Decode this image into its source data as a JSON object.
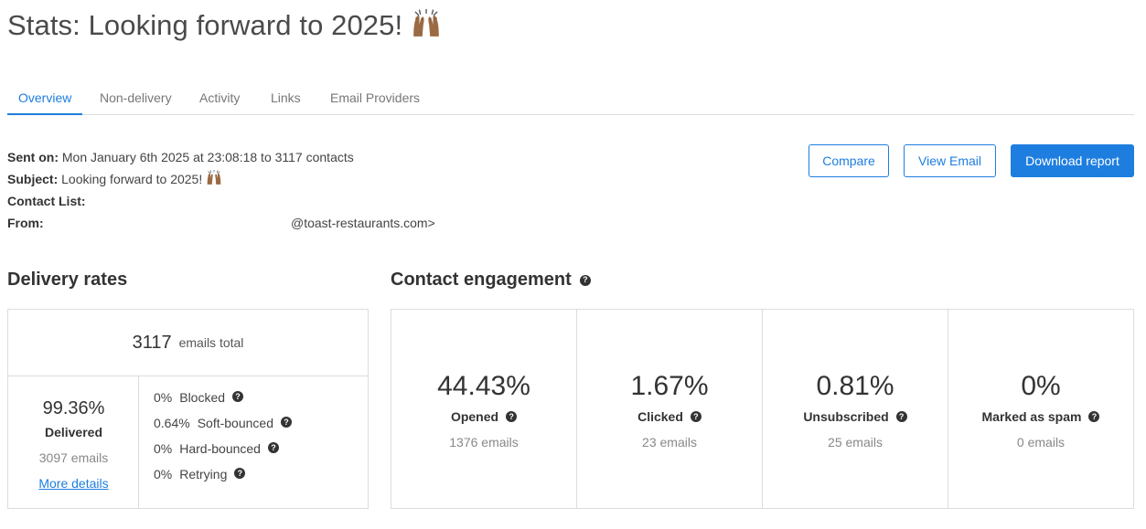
{
  "header": {
    "title": "Stats: Looking forward to 2025!",
    "emoji": "raised-hands"
  },
  "tabs": [
    {
      "label": "Overview",
      "active": true
    },
    {
      "label": "Non-delivery",
      "active": false
    },
    {
      "label": "Activity",
      "active": false
    },
    {
      "label": "Links",
      "active": false
    },
    {
      "label": "Email Providers",
      "active": false
    }
  ],
  "meta": {
    "sent_on_label": "Sent on:",
    "sent_on_value": "Mon January 6th 2025 at 23:08:18 to 3117 contacts",
    "subject_label": "Subject:",
    "subject_value": "Looking forward to 2025!",
    "contact_list_label": "Contact List:",
    "from_label": "From:",
    "from_value": "@toast-restaurants.com>"
  },
  "actions": {
    "compare": "Compare",
    "view_email": "View Email",
    "download": "Download report"
  },
  "colors": {
    "accent": "#1e7ee0",
    "border": "#dcdcdc",
    "text": "#444444"
  },
  "delivery": {
    "title": "Delivery rates",
    "total": "3117",
    "total_label": "emails total",
    "delivered_pct": "99.36%",
    "delivered_label": "Delivered",
    "delivered_count": "3097 emails",
    "more_details": "More details",
    "failures": [
      {
        "pct": "0%",
        "label": "Blocked"
      },
      {
        "pct": "0.64%",
        "label": "Soft-bounced"
      },
      {
        "pct": "0%",
        "label": "Hard-bounced"
      },
      {
        "pct": "0%",
        "label": "Retrying"
      }
    ]
  },
  "engagement": {
    "title": "Contact engagement",
    "cards": [
      {
        "pct": "44.43%",
        "label": "Opened",
        "count": "1376 emails"
      },
      {
        "pct": "1.67%",
        "label": "Clicked",
        "count": "23 emails"
      },
      {
        "pct": "0.81%",
        "label": "Unsubscribed",
        "count": "25 emails"
      },
      {
        "pct": "0%",
        "label": "Marked as spam",
        "count": "0 emails"
      }
    ]
  }
}
